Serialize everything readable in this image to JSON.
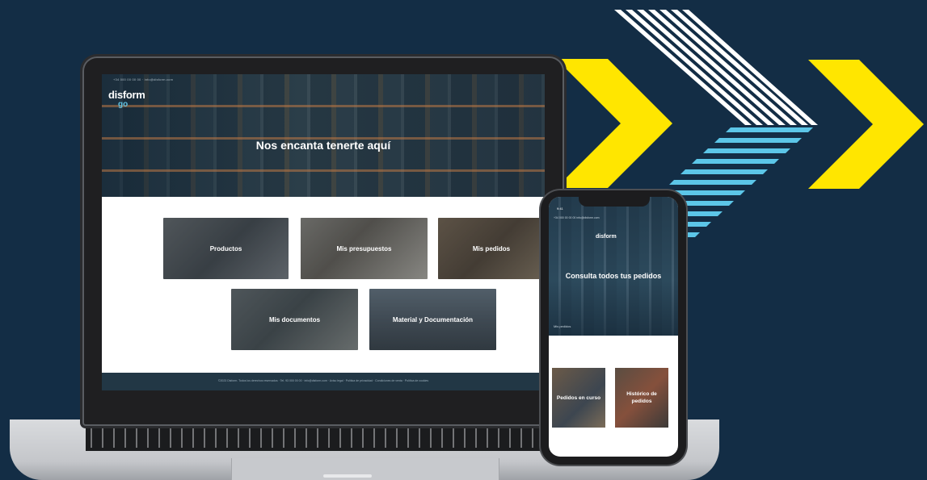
{
  "colors": {
    "background": "#132d45",
    "accent_yellow": "#ffe600",
    "accent_blue": "#5cc6e8",
    "accent_white": "#ffffff"
  },
  "laptop": {
    "top_contact": "+34 000 00 00 00   ·   info@disform.com",
    "logo_main": "disform",
    "logo_sub": "go",
    "hero_title": "Nos encanta tenerte aquí",
    "tiles": [
      "Productos",
      "Mis presupuestos",
      "Mis pedidos",
      "Mis documentos",
      "Material y Documentación"
    ],
    "footer": "©2023 Disform. Todos los derechos reservados · Tel. 93 000 00 00 · info@disform.com · Aviso legal · Política de privacidad · Condiciones de venta · Política de cookies"
  },
  "phone": {
    "time": "9:41",
    "topbar": "+34 000 00 00 00   info@disform.com",
    "brand": "disform",
    "title": "Consulta todos tus pedidos",
    "section": "Mis pedidos",
    "tiles": [
      "Pedidos en curso",
      "Histórico de pedidos"
    ]
  }
}
